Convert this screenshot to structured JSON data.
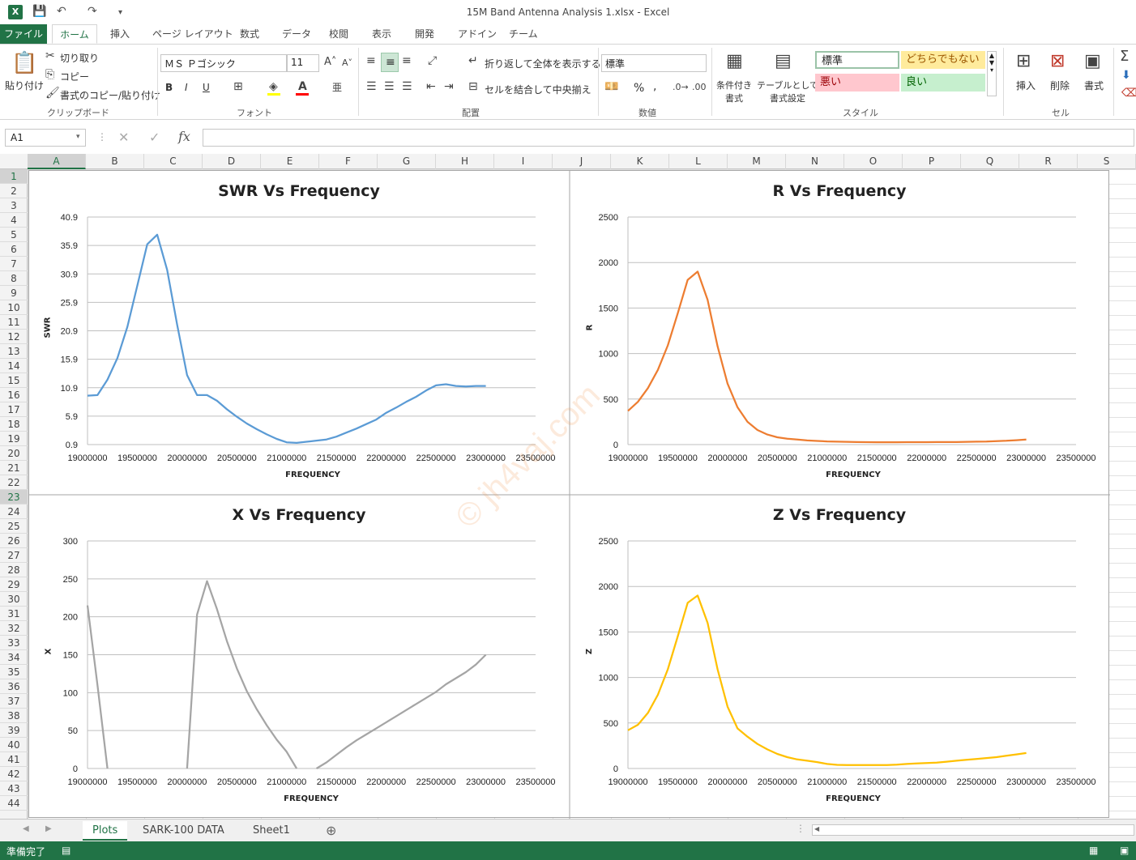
{
  "app": {
    "window_title": "15M Band  Antenna Analysis 1.xlsx - Excel",
    "logo_text": "X"
  },
  "ribbon_tabs": [
    "ファイル",
    "ホーム",
    "挿入",
    "ページ レイアウト",
    "数式",
    "データ",
    "校閲",
    "表示",
    "開発",
    "アドイン",
    "チーム"
  ],
  "ribbon": {
    "clipboard": {
      "paste": "貼り付け",
      "cut": "切り取り",
      "copy": "コピー",
      "format_painter": "書式のコピー/貼り付け",
      "group": "クリップボード"
    },
    "font": {
      "name": "ＭＳ Ｐゴシック",
      "size": "11",
      "group": "フォント",
      "bold": "B",
      "italic": "I",
      "underline": "U"
    },
    "alignment": {
      "wrap": "折り返して全体を表示する",
      "merge": "セルを結合して中央揃え",
      "group": "配置"
    },
    "number": {
      "format": "標準",
      "group": "数値",
      "percent": "%",
      "comma": ","
    },
    "styles": {
      "conditional": "条件付き\n書式",
      "table": "テーブルとして\n書式設定",
      "normal": "標準",
      "neutral": "どちらでもない",
      "bad": "悪い",
      "good": "良い",
      "group": "スタイル"
    },
    "cells": {
      "insert": "挿入",
      "delete": "削除",
      "format": "書式",
      "group": "セル"
    }
  },
  "formula_bar": {
    "name_box": "A1",
    "fx": "fx",
    "formula": ""
  },
  "columns": [
    "A",
    "B",
    "C",
    "D",
    "E",
    "F",
    "G",
    "H",
    "I",
    "J",
    "K",
    "L",
    "M",
    "N",
    "O",
    "P",
    "Q",
    "R",
    "S"
  ],
  "rows": [
    "1",
    "2",
    "3",
    "4",
    "5",
    "6",
    "7",
    "8",
    "9",
    "10",
    "11",
    "12",
    "13",
    "14",
    "15",
    "16",
    "17",
    "18",
    "19",
    "20",
    "21",
    "22",
    "23",
    "24",
    "25",
    "26",
    "27",
    "28",
    "29",
    "30",
    "31",
    "32",
    "33",
    "34",
    "35",
    "36",
    "37",
    "38",
    "39",
    "40",
    "41",
    "42",
    "43",
    "44"
  ],
  "watermark": "© jh4vaj.com",
  "chart_data": [
    {
      "type": "line",
      "title": "SWR Vs Frequency",
      "xlabel": "FREQUENCY",
      "ylabel": "SWR",
      "color": "#5B9BD5",
      "xlim": [
        19000000,
        23500000
      ],
      "ylim": [
        0.9,
        40.9
      ],
      "xticks": [
        "19000000",
        "19500000",
        "20000000",
        "20500000",
        "21000000",
        "21500000",
        "22000000",
        "22500000",
        "23000000",
        "23500000"
      ],
      "yticks": [
        "0.9",
        "5.9",
        "10.9",
        "15.9",
        "20.9",
        "25.9",
        "30.9",
        "35.9",
        "40.9"
      ],
      "x": [
        19000000,
        19100000,
        19200000,
        19300000,
        19400000,
        19500000,
        19600000,
        19700000,
        19800000,
        19900000,
        20000000,
        20100000,
        20200000,
        20300000,
        20400000,
        20500000,
        20600000,
        20700000,
        20800000,
        20900000,
        21000000,
        21100000,
        21200000,
        21300000,
        21400000,
        21500000,
        21600000,
        21700000,
        21800000,
        21900000,
        22000000,
        22100000,
        22200000,
        22300000,
        22400000,
        22500000,
        22600000,
        22700000,
        22800000,
        22900000,
        23000000
      ],
      "values": [
        9.5,
        9.6,
        12.3,
        16.1,
        21.6,
        28.8,
        36.1,
        37.8,
        31.6,
        22.0,
        13.1,
        9.6,
        9.6,
        8.6,
        7.1,
        5.8,
        4.6,
        3.6,
        2.7,
        1.9,
        1.3,
        1.2,
        1.4,
        1.6,
        1.8,
        2.3,
        3.0,
        3.7,
        4.5,
        5.3,
        6.5,
        7.4,
        8.4,
        9.3,
        10.4,
        11.3,
        11.5,
        11.2,
        11.1,
        11.2,
        11.2
      ]
    },
    {
      "type": "line",
      "title": "R Vs Frequency",
      "xlabel": "FREQUENCY",
      "ylabel": "R",
      "color": "#ED7D31",
      "xlim": [
        19000000,
        23500000
      ],
      "ylim": [
        0,
        2500
      ],
      "xticks": [
        "19000000",
        "19500000",
        "20000000",
        "20500000",
        "21000000",
        "21500000",
        "22000000",
        "22500000",
        "23000000",
        "23500000"
      ],
      "yticks": [
        "0",
        "500",
        "1000",
        "1500",
        "2000",
        "2500"
      ],
      "x": [
        19000000,
        19100000,
        19200000,
        19300000,
        19400000,
        19500000,
        19600000,
        19700000,
        19800000,
        19900000,
        20000000,
        20100000,
        20200000,
        20300000,
        20400000,
        20500000,
        20600000,
        20700000,
        20800000,
        20900000,
        21000000,
        21100000,
        21200000,
        21300000,
        21400000,
        21500000,
        21600000,
        21700000,
        21800000,
        21900000,
        22000000,
        22100000,
        22200000,
        22300000,
        22400000,
        22500000,
        22600000,
        22700000,
        22800000,
        22900000,
        23000000
      ],
      "values": [
        370,
        470,
        620,
        820,
        1090,
        1440,
        1810,
        1900,
        1590,
        1080,
        670,
        410,
        250,
        160,
        110,
        80,
        65,
        55,
        45,
        40,
        35,
        32,
        30,
        28,
        27,
        26,
        26,
        26,
        27,
        27,
        27,
        28,
        28,
        28,
        30,
        32,
        34,
        38,
        42,
        48,
        55
      ]
    },
    {
      "type": "line",
      "title": "X Vs Frequency",
      "xlabel": "FREQUENCY",
      "ylabel": "X",
      "color": "#A5A5A5",
      "xlim": [
        19000000,
        23500000
      ],
      "ylim": [
        0,
        300
      ],
      "xticks": [
        "19000000",
        "19500000",
        "20000000",
        "20500000",
        "21000000",
        "21500000",
        "22000000",
        "22500000",
        "23000000",
        "23500000"
      ],
      "yticks": [
        "0",
        "50",
        "100",
        "150",
        "200",
        "250",
        "300"
      ],
      "segments": [
        {
          "x": [
            19000000,
            19100000,
            19200000
          ],
          "values": [
            215,
            110,
            0
          ]
        },
        {
          "x": [
            20000000,
            20100000,
            20200000,
            20300000,
            20400000,
            20500000,
            20600000,
            20700000,
            20800000,
            20900000,
            21000000,
            21100000
          ],
          "values": [
            0,
            203,
            247,
            210,
            168,
            132,
            102,
            78,
            57,
            38,
            22,
            0
          ]
        },
        {
          "x": [
            21300000,
            21400000,
            21500000,
            21600000,
            21700000,
            21800000,
            21900000,
            22000000,
            22100000,
            22200000,
            22300000,
            22400000,
            22500000,
            22600000,
            22700000,
            22800000,
            22900000,
            23000000
          ],
          "values": [
            0,
            8,
            18,
            28,
            37,
            45,
            53,
            61,
            69,
            77,
            85,
            93,
            101,
            111,
            119,
            127,
            137,
            150
          ]
        }
      ]
    },
    {
      "type": "line",
      "title": "Z Vs Frequency",
      "xlabel": "FREQUENCY",
      "ylabel": "Z",
      "color": "#FFC000",
      "xlim": [
        19000000,
        23500000
      ],
      "ylim": [
        0,
        2500
      ],
      "xticks": [
        "19000000",
        "19500000",
        "20000000",
        "20500000",
        "21000000",
        "21500000",
        "22000000",
        "22500000",
        "23000000",
        "23500000"
      ],
      "yticks": [
        "0",
        "500",
        "1000",
        "1500",
        "2000",
        "2500"
      ],
      "x": [
        19000000,
        19100000,
        19200000,
        19300000,
        19400000,
        19500000,
        19600000,
        19700000,
        19800000,
        19900000,
        20000000,
        20100000,
        20200000,
        20300000,
        20400000,
        20500000,
        20600000,
        20700000,
        20800000,
        20900000,
        21000000,
        21100000,
        21200000,
        21300000,
        21400000,
        21500000,
        21600000,
        21700000,
        21800000,
        21900000,
        22000000,
        22100000,
        22200000,
        22300000,
        22400000,
        22500000,
        22600000,
        22700000,
        22800000,
        22900000,
        23000000
      ],
      "values": [
        420,
        480,
        610,
        810,
        1090,
        1450,
        1820,
        1900,
        1600,
        1090,
        680,
        440,
        350,
        270,
        210,
        160,
        125,
        100,
        85,
        70,
        50,
        40,
        38,
        38,
        38,
        38,
        38,
        42,
        50,
        55,
        60,
        65,
        75,
        85,
        95,
        105,
        115,
        125,
        140,
        155,
        170
      ]
    }
  ],
  "sheet_tabs": [
    "Plots",
    "SARK-100 DATA",
    "Sheet1"
  ],
  "status": {
    "ready": "準備完了"
  }
}
